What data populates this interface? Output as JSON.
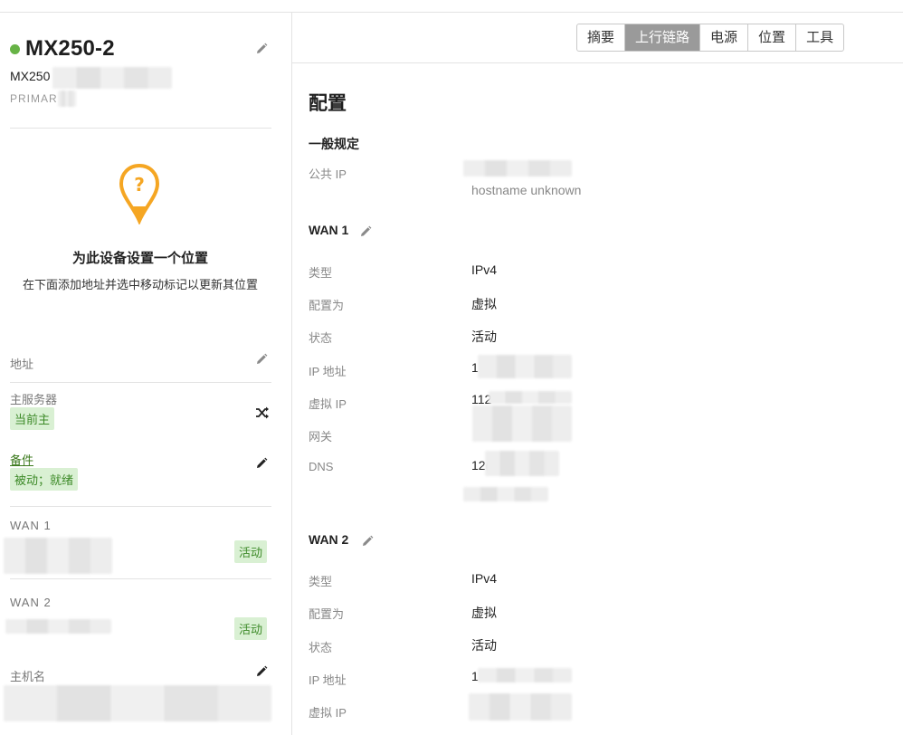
{
  "device": {
    "name": "MX250-2",
    "model": "MX250",
    "role": "PRIMAR",
    "status_color": "#67b346"
  },
  "location": {
    "title": "为此设备设置一个位置",
    "description": "在下面添加地址并选中移动标记以更新其位置"
  },
  "left_fields": {
    "address_label": "地址",
    "primary_label": "主服务器",
    "primary_tag": "当前主",
    "spare_label": "备件",
    "spare_tag": "被动；就绪",
    "wan1_label": "WAN 1",
    "wan1_tag": "活动",
    "wan2_label": "WAN 2",
    "wan2_tag": "活动",
    "hostname_label": "主机名"
  },
  "tabs": [
    {
      "label": "摘要",
      "active": false
    },
    {
      "label": "上行链路",
      "active": true
    },
    {
      "label": "电源",
      "active": false
    },
    {
      "label": "位置",
      "active": false
    },
    {
      "label": "工具",
      "active": false
    }
  ],
  "config": {
    "title": "配置",
    "general_title": "一般规定",
    "public_ip_label": "公共 IP",
    "hostname_value": "hostname unknown",
    "wan1": {
      "title": "WAN 1",
      "type_label": "类型",
      "type_value": "IPv4",
      "config_label": "配置为",
      "config_value": "虚拟",
      "status_label": "状态",
      "status_value": "活动",
      "ip_label": "IP 地址",
      "ip_value": "1",
      "vip_label": "虚拟 IP",
      "vip_value": "112",
      "gateway_label": "网关",
      "dns_label": "DNS",
      "dns_value": "12("
    },
    "wan2": {
      "title": "WAN 2",
      "type_label": "类型",
      "type_value": "IPv4",
      "config_label": "配置为",
      "config_value": "虚拟",
      "status_label": "状态",
      "status_value": "活动",
      "ip_label": "IP 地址",
      "ip_value": "1",
      "vip_label": "虚拟 IP"
    }
  },
  "icons": {
    "edit": "pencil-icon",
    "shuffle": "shuffle-icon",
    "location": "location-pin-icon"
  },
  "colors": {
    "accent_green": "#67b346",
    "tag_bg": "#d9f0d3",
    "tag_text": "#3d8a28",
    "pin": "#f5a623",
    "tab_active": "#9a9a9a"
  }
}
